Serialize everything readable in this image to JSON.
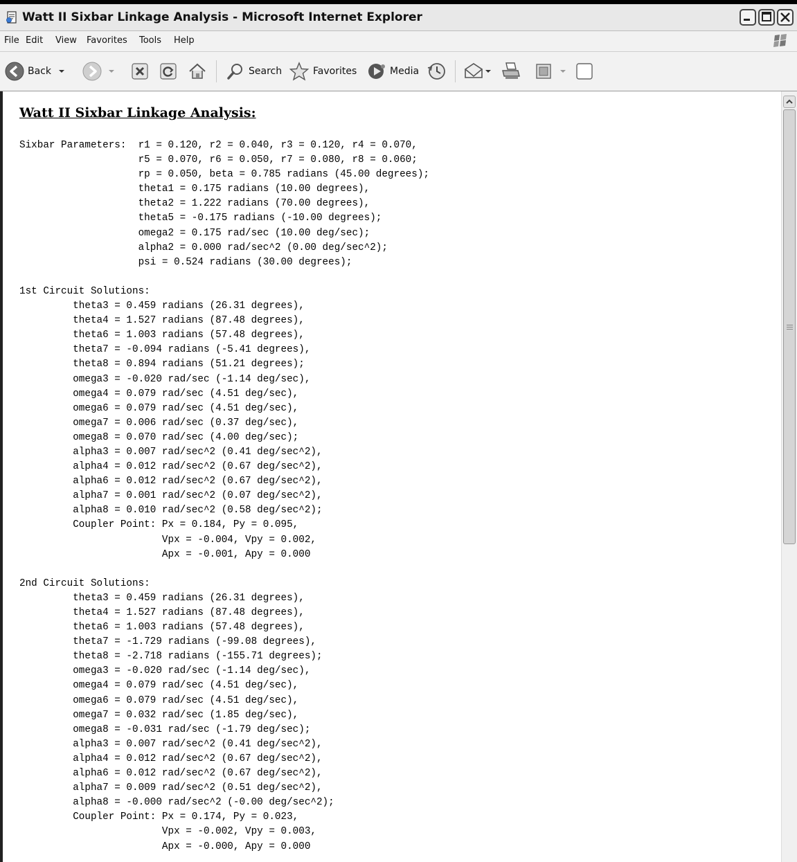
{
  "window": {
    "title": "Watt II Sixbar Linkage Analysis - Microsoft Internet Explorer"
  },
  "menubar": {
    "items": [
      "File",
      "Edit",
      "View",
      "Favorites",
      "Tools",
      "Help"
    ]
  },
  "toolbar": {
    "back_label": "Back",
    "search_label": "Search",
    "favorites_label": "Favorites",
    "media_label": "Media"
  },
  "page": {
    "heading": "Watt II Sixbar Linkage Analysis",
    "heading_suffix": ":",
    "output_text": "Sixbar Parameters:  r1 = 0.120, r2 = 0.040, r3 = 0.120, r4 = 0.070,\n                    r5 = 0.070, r6 = 0.050, r7 = 0.080, r8 = 0.060;\n                    rp = 0.050, beta = 0.785 radians (45.00 degrees);\n                    theta1 = 0.175 radians (10.00 degrees),\n                    theta2 = 1.222 radians (70.00 degrees),\n                    theta5 = -0.175 radians (-10.00 degrees);\n                    omega2 = 0.175 rad/sec (10.00 deg/sec);\n                    alpha2 = 0.000 rad/sec^2 (0.00 deg/sec^2);\n                    psi = 0.524 radians (30.00 degrees);\n\n1st Circuit Solutions:\n         theta3 = 0.459 radians (26.31 degrees),\n         theta4 = 1.527 radians (87.48 degrees),\n         theta6 = 1.003 radians (57.48 degrees),\n         theta7 = -0.094 radians (-5.41 degrees),\n         theta8 = 0.894 radians (51.21 degrees);\n         omega3 = -0.020 rad/sec (-1.14 deg/sec),\n         omega4 = 0.079 rad/sec (4.51 deg/sec),\n         omega6 = 0.079 rad/sec (4.51 deg/sec),\n         omega7 = 0.006 rad/sec (0.37 deg/sec),\n         omega8 = 0.070 rad/sec (4.00 deg/sec);\n         alpha3 = 0.007 rad/sec^2 (0.41 deg/sec^2),\n         alpha4 = 0.012 rad/sec^2 (0.67 deg/sec^2),\n         alpha6 = 0.012 rad/sec^2 (0.67 deg/sec^2),\n         alpha7 = 0.001 rad/sec^2 (0.07 deg/sec^2),\n         alpha8 = 0.010 rad/sec^2 (0.58 deg/sec^2);\n         Coupler Point: Px = 0.184, Py = 0.095,\n                        Vpx = -0.004, Vpy = 0.002,\n                        Apx = -0.001, Apy = 0.000\n\n2nd Circuit Solutions:\n         theta3 = 0.459 radians (26.31 degrees),\n         theta4 = 1.527 radians (87.48 degrees),\n         theta6 = 1.003 radians (57.48 degrees),\n         theta7 = -1.729 radians (-99.08 degrees),\n         theta8 = -2.718 radians (-155.71 degrees);\n         omega3 = -0.020 rad/sec (-1.14 deg/sec),\n         omega4 = 0.079 rad/sec (4.51 deg/sec),\n         omega6 = 0.079 rad/sec (4.51 deg/sec),\n         omega7 = 0.032 rad/sec (1.85 deg/sec),\n         omega8 = -0.031 rad/sec (-1.79 deg/sec);\n         alpha3 = 0.007 rad/sec^2 (0.41 deg/sec^2),\n         alpha4 = 0.012 rad/sec^2 (0.67 deg/sec^2),\n         alpha6 = 0.012 rad/sec^2 (0.67 deg/sec^2),\n         alpha7 = 0.009 rad/sec^2 (0.51 deg/sec^2),\n         alpha8 = -0.000 rad/sec^2 (-0.00 deg/sec^2);\n         Coupler Point: Px = 0.174, Py = 0.023,\n                        Vpx = -0.002, Vpy = 0.003,\n                        Apx = -0.000, Apy = 0.000"
  }
}
